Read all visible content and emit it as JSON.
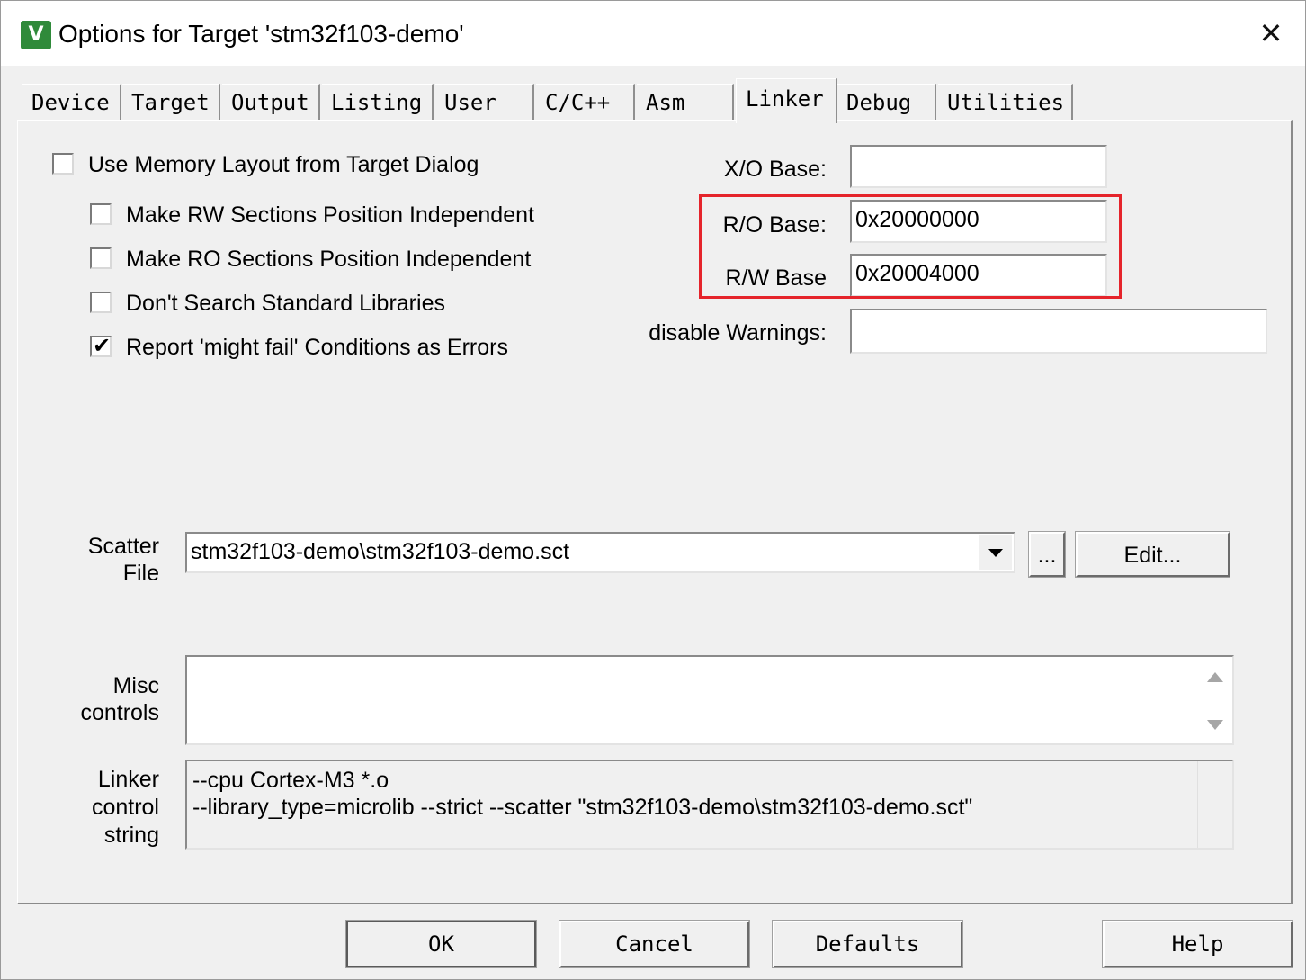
{
  "window": {
    "title": "Options for Target 'stm32f103-demo'",
    "icon_text": "V",
    "close_glyph": "✕",
    "accent_icon_color": "#2f8a3a",
    "highlight_color": "#e5242b"
  },
  "tabs": [
    {
      "label": "Device"
    },
    {
      "label": "Target"
    },
    {
      "label": "Output"
    },
    {
      "label": "Listing"
    },
    {
      "label": "User"
    },
    {
      "label": "C/C++"
    },
    {
      "label": "Asm"
    },
    {
      "label": "Linker",
      "active": true
    },
    {
      "label": "Debug"
    },
    {
      "label": "Utilities"
    }
  ],
  "options": [
    {
      "label": "Use Memory Layout from Target Dialog",
      "checked": false
    },
    {
      "label": "Make RW Sections Position Independent",
      "checked": false
    },
    {
      "label": "Make RO Sections Position Independent",
      "checked": false
    },
    {
      "label": "Don't Search Standard Libraries",
      "checked": false
    },
    {
      "label": "Report 'might fail' Conditions as Errors",
      "checked": true
    }
  ],
  "check_mark": "✔",
  "fields": {
    "xo_base": {
      "label": "X/O Base:",
      "value": ""
    },
    "ro_base": {
      "label": "R/O Base:",
      "value": "0x20000000"
    },
    "rw_base": {
      "label": "R/W Base",
      "value": "0x20004000"
    },
    "disable_warnings": {
      "label": "disable Warnings:",
      "value": ""
    }
  },
  "scatter": {
    "label_line1": "Scatter",
    "label_line2": "File",
    "value": "stm32f103-demo\\stm32f103-demo.sct",
    "browse_label": "...",
    "edit_label": "Edit..."
  },
  "misc": {
    "label_line1": "Misc",
    "label_line2": "controls",
    "value": ""
  },
  "linker_control": {
    "label_line1": "Linker",
    "label_line2": "control",
    "label_line3": "string",
    "line1": "--cpu Cortex-M3 *.o",
    "line2": "--library_type=microlib --strict --scatter \"stm32f103-demo\\stm32f103-demo.sct\""
  },
  "buttons": {
    "ok": "OK",
    "cancel": "Cancel",
    "defaults": "Defaults",
    "help": "Help"
  }
}
